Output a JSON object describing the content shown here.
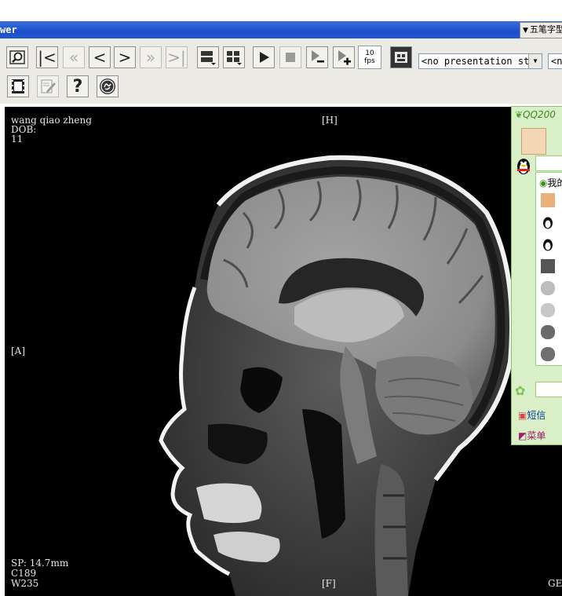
{
  "window": {
    "title": "wer",
    "ime_label": "五笔字型"
  },
  "toolbar": {
    "fps_value": "10",
    "fps_unit": "fps",
    "presentation_select": "<no presentation st",
    "second_select": "<n"
  },
  "overlay": {
    "patient_name": "wang qiao zheng",
    "dob_label": "DOB:",
    "age_value": "11",
    "head_marker": "[H]",
    "anterior_marker": "[A]",
    "foot_marker": "[F]",
    "spacing": "SP: 14.7mm",
    "center": "C189",
    "width": "W235",
    "vendor": "GE"
  },
  "qq_panel": {
    "title": "QQ200",
    "group_label": "我的",
    "sms_label": "短信",
    "menu_label": "菜单"
  },
  "colors": {
    "titlebar": "#1d4fc9",
    "toolbar": "#eceae4",
    "viewer_background": "#000000",
    "qq_panel": "#d9efc7"
  }
}
